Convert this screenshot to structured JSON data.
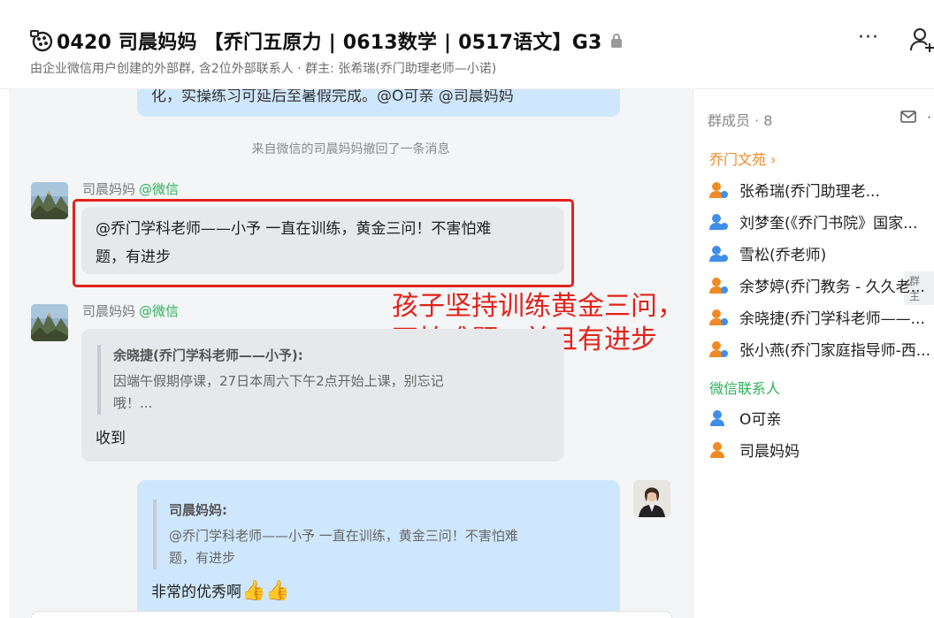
{
  "header": {
    "title": "0420 司晨妈妈 【乔门五原力 | 0613数学 | 0517语文】G3",
    "subtitle": "由企业微信用户创建的外部群, 含2位外部联系人 · 群主: 张希瑞(乔门助理老师—小诺)",
    "more_label": "···"
  },
  "chat": {
    "top_partial_text": "化，实操练习可延后至暑假完成。@O可亲 @司晨妈妈",
    "system_message": "来自微信的司晨妈妈撤回了一条消息",
    "messages": [
      {
        "sender": "司晨妈妈",
        "source": "@微信",
        "text_line1": "@乔门学科老师——小予 一直在训练，黄金三问！不害怕难",
        "text_line2": "题，有进步"
      },
      {
        "sender": "司晨妈妈",
        "source": "@微信",
        "quote_name": "余晓捷(乔门学科老师——小予):",
        "quote_line1": "因端午假期停课，27日本周六下午2点开始上课，别忘记",
        "quote_line2": "哦！...",
        "text": "收到"
      },
      {
        "quote_name": "司晨妈妈:",
        "quote_line1": "@乔门学科老师——小予 一直在训练，黄金三问！不害怕难",
        "quote_line2": "题，有进步",
        "text": "非常的优秀啊",
        "emoji": "👍👍"
      }
    ],
    "annotation_line1": "孩子坚持训练黄金三问，",
    "annotation_line2": "不怕难题，并且有进步"
  },
  "sidebar": {
    "members_header": "群成员 · 8",
    "section_org": "乔门文苑 ›",
    "owner_badge": "群主",
    "members": [
      {
        "name": "张希瑞(乔门助理老...",
        "color": "orange"
      },
      {
        "name": "刘梦奎(《乔门书院》国家...",
        "color": "blue"
      },
      {
        "name": "雪松(乔老师)",
        "color": "blue"
      },
      {
        "name": "余梦婷(乔门教务 - 久久老...",
        "color": "orange"
      },
      {
        "name": "余晓捷(乔门学科老师——...",
        "color": "orange"
      },
      {
        "name": "张小燕(乔门家庭指导师-西...",
        "color": "orange"
      }
    ],
    "section_wechat": "微信联系人",
    "wechat_members": [
      {
        "name": "O可亲",
        "color": "blue"
      },
      {
        "name": "司晨妈妈",
        "color": "orange"
      }
    ]
  },
  "colors": {
    "accent_orange": "#f08a24",
    "wechat_green": "#2eb25a",
    "member_blue": "#3f8fe8",
    "annotation_red": "#e2231a",
    "bubble_blue": "#cfe7fc",
    "bubble_gray": "#e6e8eb"
  }
}
